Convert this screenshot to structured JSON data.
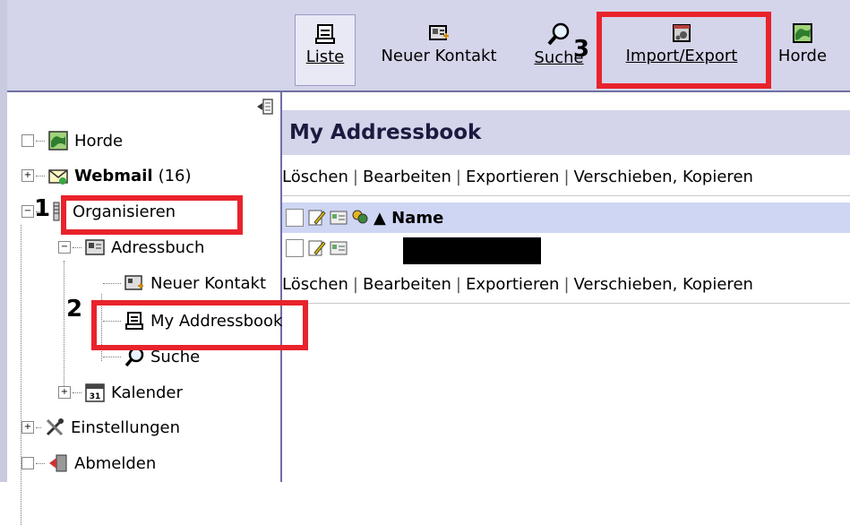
{
  "toolbar": {
    "items": [
      {
        "label": "Liste",
        "icon": "list-icon"
      },
      {
        "label": "Neuer Kontakt",
        "icon": "new-contact-icon"
      },
      {
        "label": "Suche",
        "icon": "search-icon"
      },
      {
        "label": "Import/Export",
        "icon": "import-export-icon"
      },
      {
        "label": "Horde",
        "icon": "horde-icon"
      }
    ]
  },
  "sidebar": {
    "items": [
      {
        "label": "Horde"
      },
      {
        "label": "Webmail",
        "count": "(16)"
      },
      {
        "label": "Organisieren"
      },
      {
        "label": "Adressbuch"
      },
      {
        "label": "Neuer Kontakt"
      },
      {
        "label": "My Addressbook"
      },
      {
        "label": "Suche"
      },
      {
        "label": "Kalender"
      },
      {
        "label": "Einstellungen"
      },
      {
        "label": "Abmelden"
      }
    ]
  },
  "main": {
    "title": "My Addressbook",
    "actions": [
      "Löschen",
      "Bearbeiten",
      "Exportieren",
      "Verschieben, Kopieren"
    ],
    "column_name": "▲ Name"
  },
  "annotations": [
    "1",
    "2",
    "3"
  ],
  "colors": {
    "toolbar_bg": "#d4d4ea",
    "accent_red": "#e8232b",
    "header_blue": "#cfd6f4"
  }
}
